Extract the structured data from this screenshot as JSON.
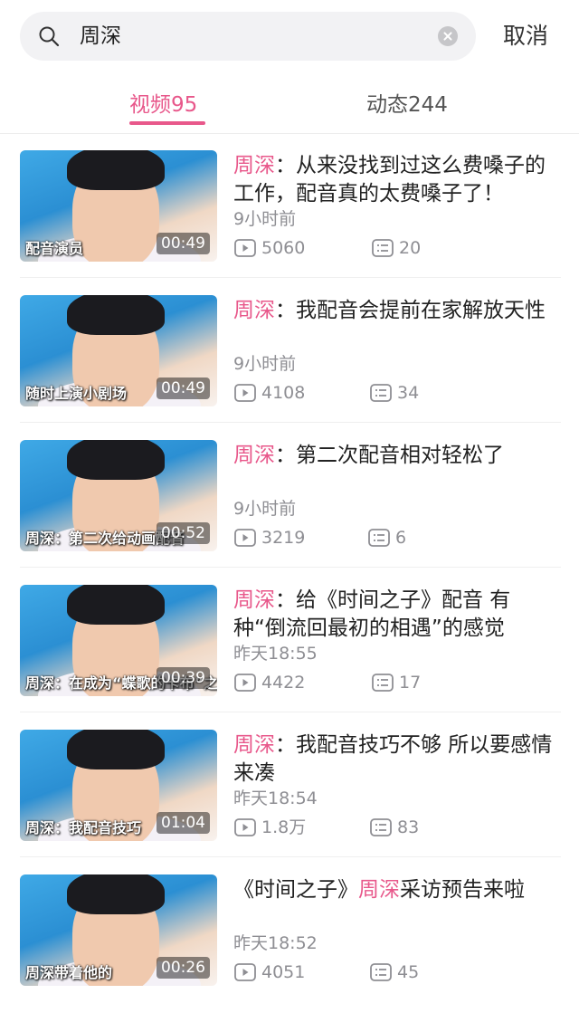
{
  "search": {
    "query": "周深"
  },
  "header": {
    "cancel_label": "取消"
  },
  "tabs": [
    {
      "label": "视频95",
      "active": true
    },
    {
      "label": "动态244",
      "active": false
    }
  ],
  "colors": {
    "accent": "#e8588b",
    "meta": "#8e8e93"
  },
  "icons": {
    "search": "search-icon",
    "clear": "clear-icon",
    "play": "play-icon",
    "comment": "comment-icon"
  },
  "videos": [
    {
      "title_parts": [
        "周深",
        "：从来没找到过这么费嗓子的工作，配音真的太费嗓子了！"
      ],
      "time": "9小时前",
      "plays": "5060",
      "comments": "20",
      "duration": "00:49",
      "caption": "配音演员"
    },
    {
      "title_parts": [
        "周深",
        "：我配音会提前在家解放天性"
      ],
      "time": "9小时前",
      "plays": "4108",
      "comments": "34",
      "duration": "00:49",
      "caption": "随时上演小剧场"
    },
    {
      "title_parts": [
        "周深",
        "：第二次配音相对轻松了"
      ],
      "time": "9小时前",
      "plays": "3219",
      "comments": "6",
      "duration": "00:52",
      "caption": "周深：第二次给动画配音"
    },
    {
      "title_parts": [
        "周深",
        "：给《时间之子》配音 有种“倒流回最初的相遇”的感觉"
      ],
      "time": "昨天18:55",
      "plays": "4422",
      "comments": "17",
      "duration": "00:39",
      "caption": "周深：在成为“蝶歌的卡布”之前"
    },
    {
      "title_parts": [
        "周深",
        "：我配音技巧不够 所以要感情来凑"
      ],
      "time": "昨天18:54",
      "plays": "1.8万",
      "comments": "83",
      "duration": "01:04",
      "caption": "周深：我配音技巧"
    },
    {
      "title_parts": [
        "《时间之子》",
        "周深",
        "采访预告来啦"
      ],
      "time": "昨天18:52",
      "plays": "4051",
      "comments": "45",
      "duration": "00:26",
      "caption": "周深带着他的"
    }
  ]
}
